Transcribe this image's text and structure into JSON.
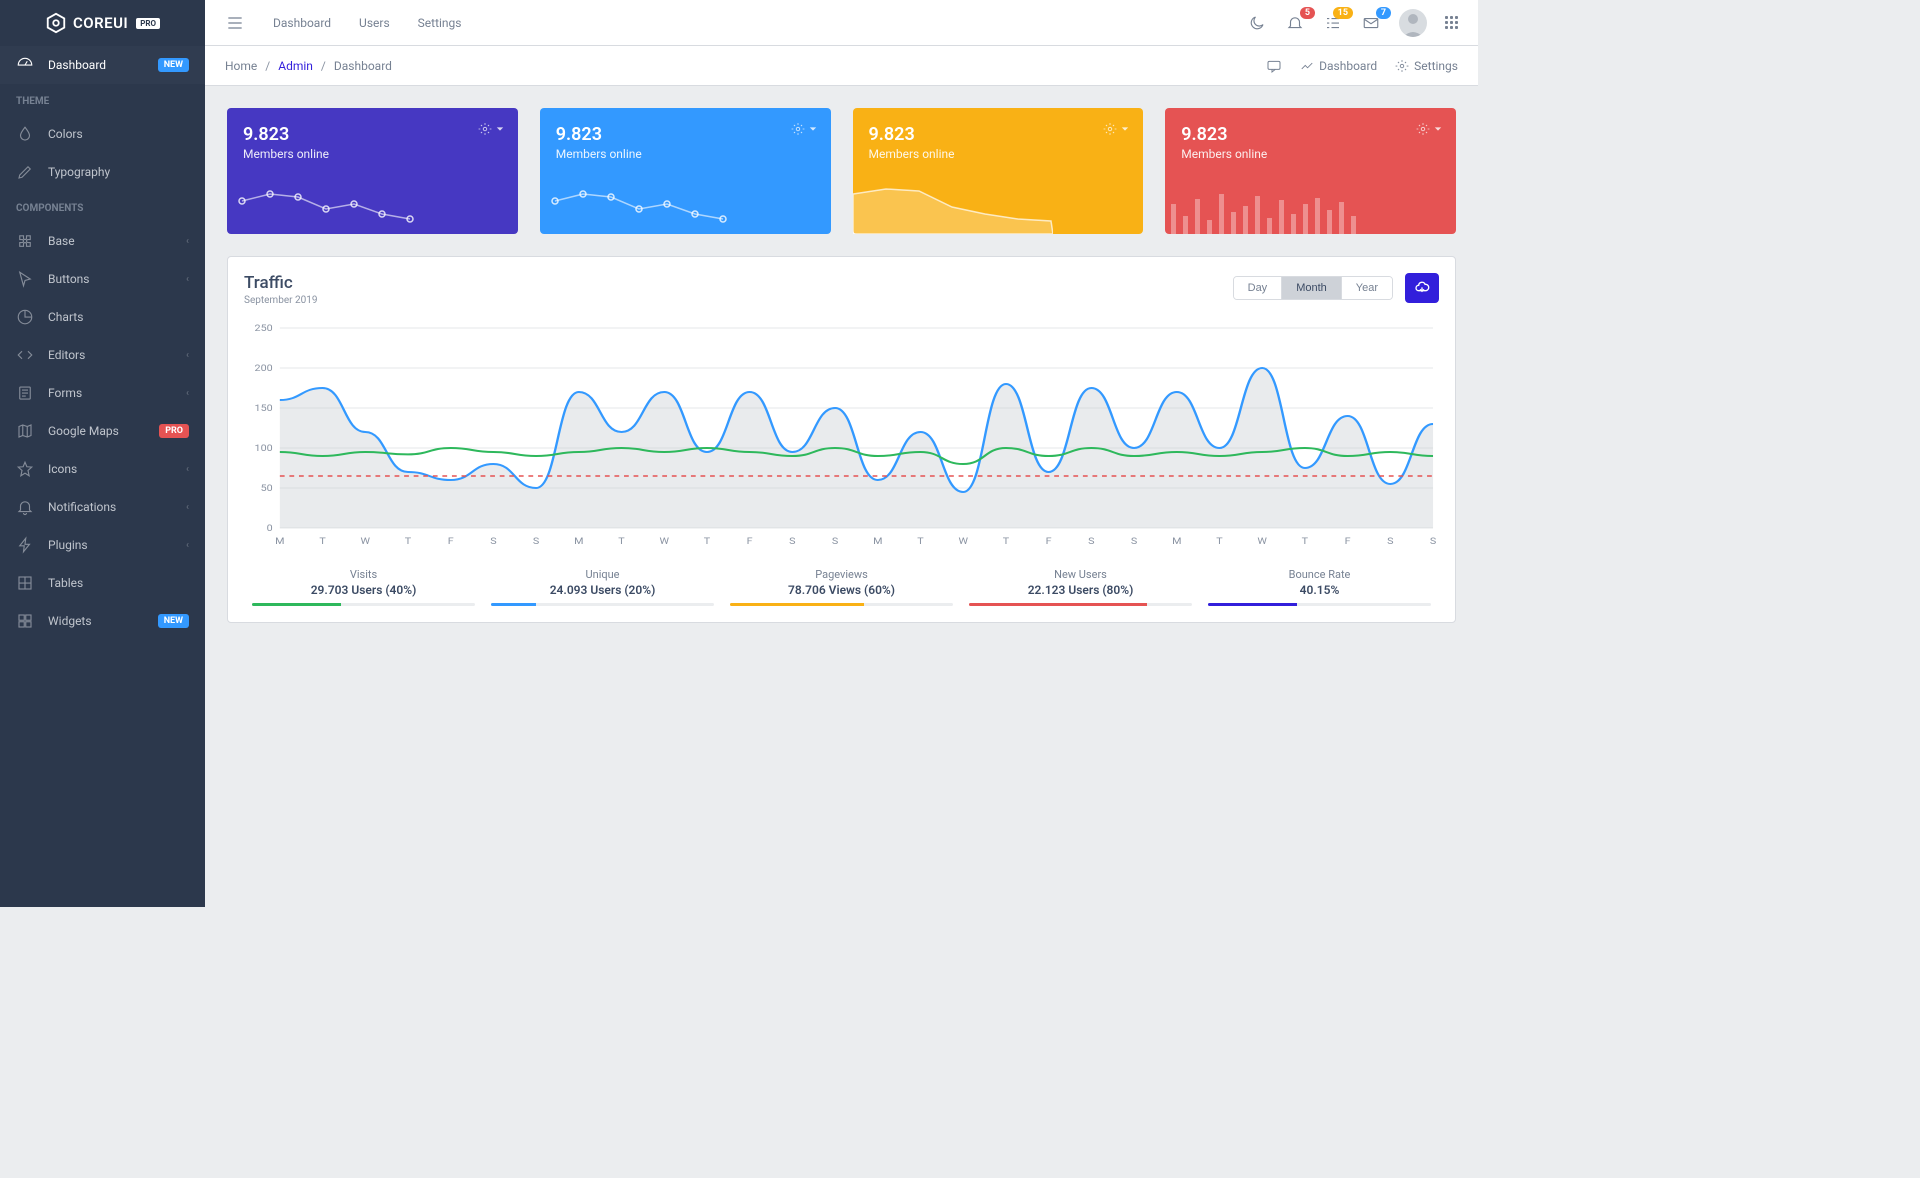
{
  "brand": {
    "name": "COREUI",
    "badge": "PRO"
  },
  "sidebar": {
    "dashboard": {
      "label": "Dashboard",
      "badge": "NEW"
    },
    "theme_title": "THEME",
    "colors": {
      "label": "Colors"
    },
    "typography": {
      "label": "Typography"
    },
    "components_title": "COMPONENTS",
    "base": {
      "label": "Base"
    },
    "buttons": {
      "label": "Buttons"
    },
    "charts": {
      "label": "Charts"
    },
    "editors": {
      "label": "Editors"
    },
    "forms": {
      "label": "Forms"
    },
    "googlemaps": {
      "label": "Google Maps",
      "badge": "PRO"
    },
    "icons": {
      "label": "Icons"
    },
    "notifications": {
      "label": "Notifications"
    },
    "plugins": {
      "label": "Plugins"
    },
    "tables": {
      "label": "Tables"
    },
    "widgets": {
      "label": "Widgets",
      "badge": "NEW"
    }
  },
  "header": {
    "nav": {
      "dashboard": "Dashboard",
      "users": "Users",
      "settings": "Settings"
    },
    "badges": {
      "bell": "5",
      "list": "15",
      "mail": "7"
    }
  },
  "breadcrumb": {
    "home": "Home",
    "admin": "Admin",
    "dashboard": "Dashboard"
  },
  "subheader": {
    "dashboard": "Dashboard",
    "settings": "Settings"
  },
  "widgets": [
    {
      "value": "9.823",
      "label": "Members online"
    },
    {
      "value": "9.823",
      "label": "Members online"
    },
    {
      "value": "9.823",
      "label": "Members online"
    },
    {
      "value": "9.823",
      "label": "Members online"
    }
  ],
  "traffic": {
    "title": "Traffic",
    "subtitle": "September 2019",
    "periods": {
      "day": "Day",
      "month": "Month",
      "year": "Year"
    },
    "stats": [
      {
        "label": "Visits",
        "value": "29.703 Users (40%)",
        "color": "#2eb85c",
        "pct": 40
      },
      {
        "label": "Unique",
        "value": "24.093 Users (20%)",
        "color": "#39f",
        "pct": 20
      },
      {
        "label": "Pageviews",
        "value": "78.706 Views (60%)",
        "color": "#f9b115",
        "pct": 60
      },
      {
        "label": "New Users",
        "value": "22.123 Users (80%)",
        "color": "#e55353",
        "pct": 80
      },
      {
        "label": "Bounce Rate",
        "value": "40.15%",
        "color": "#321fdb",
        "pct": 40
      }
    ]
  },
  "chart_data": {
    "type": "line",
    "title": "Traffic",
    "xlabel": "",
    "ylabel": "",
    "ylim": [
      0,
      250
    ],
    "categories": [
      "M",
      "T",
      "W",
      "T",
      "F",
      "S",
      "S",
      "M",
      "T",
      "W",
      "T",
      "F",
      "S",
      "S",
      "M",
      "T",
      "W",
      "T",
      "F",
      "S",
      "S",
      "M",
      "T",
      "W",
      "T",
      "F",
      "S",
      "S"
    ],
    "series": [
      {
        "name": "main",
        "color": "#39f",
        "values": [
          160,
          175,
          120,
          70,
          60,
          80,
          50,
          170,
          120,
          170,
          95,
          170,
          95,
          150,
          60,
          120,
          45,
          180,
          70,
          175,
          100,
          170,
          100,
          200,
          75,
          140,
          55,
          130
        ]
      },
      {
        "name": "secondary",
        "color": "#2eb85c",
        "values": [
          95,
          90,
          95,
          92,
          100,
          95,
          90,
          95,
          100,
          95,
          100,
          95,
          90,
          100,
          90,
          95,
          80,
          100,
          90,
          100,
          90,
          95,
          90,
          95,
          100,
          90,
          95,
          90
        ]
      },
      {
        "name": "threshold",
        "color": "#e55353",
        "values": [
          65,
          65,
          65,
          65,
          65,
          65,
          65,
          65,
          65,
          65,
          65,
          65,
          65,
          65,
          65,
          65,
          65,
          65,
          65,
          65,
          65,
          65,
          65,
          65,
          65,
          65,
          65,
          65
        ]
      }
    ]
  }
}
